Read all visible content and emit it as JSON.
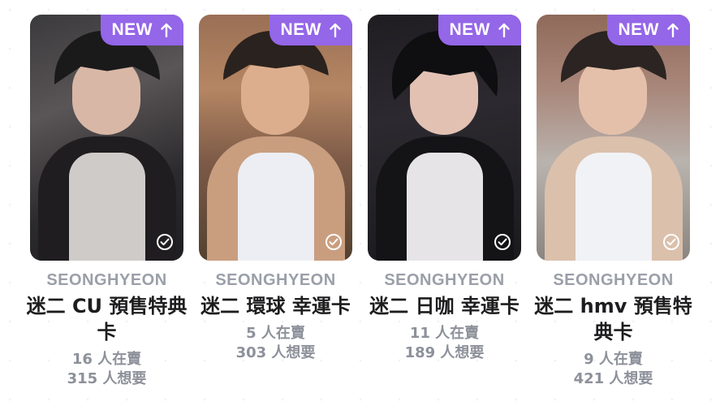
{
  "cards": [
    {
      "badge": "NEW",
      "artist": "SEONGHYEON",
      "title": "迷二 CU 預售特典卡",
      "sellers": "16 人在賣",
      "wanters": "315 人想要"
    },
    {
      "badge": "NEW",
      "artist": "SEONGHYEON",
      "title": "迷二 環球 幸運卡",
      "sellers": "5 人在賣",
      "wanters": "303 人想要"
    },
    {
      "badge": "NEW",
      "artist": "SEONGHYEON",
      "title": "迷二 日咖 幸運卡",
      "sellers": "11 人在賣",
      "wanters": "189 人想要"
    },
    {
      "badge": "NEW",
      "artist": "SEONGHYEON",
      "title": "迷二 hmv 預售特典卡",
      "sellers": "9 人在賣",
      "wanters": "421 人想要"
    }
  ],
  "colors": {
    "badge": "#9466e8",
    "artist_text": "#9a9fa8",
    "title_text": "#1d1d1f",
    "stats_text": "#8d919a"
  },
  "icons": {
    "badge_arrow": "arrow-up-icon",
    "check": "check-circle-icon"
  }
}
